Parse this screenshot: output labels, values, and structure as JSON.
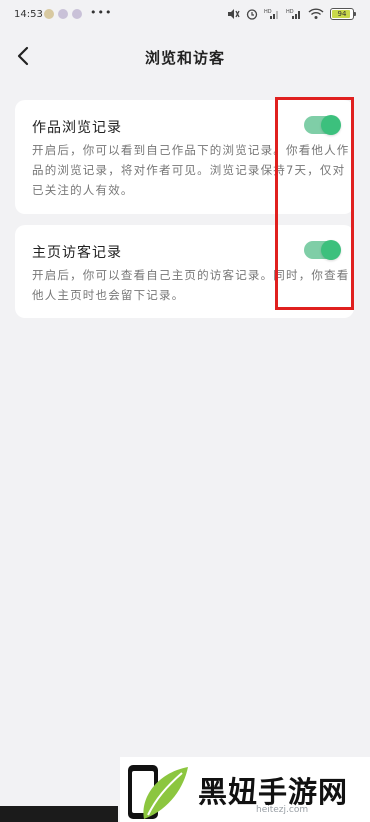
{
  "status_bar": {
    "time": "14:53",
    "more": "•••",
    "battery_level": 0.9,
    "battery_text": "94",
    "icons": [
      "notification-icon",
      "notification-icon",
      "mute-icon",
      "alarm-icon",
      "signal-hd-icon",
      "signal-hd-icon",
      "wifi-icon",
      "battery-icon"
    ]
  },
  "header": {
    "title": "浏览和访客",
    "back_icon": "chevron-left-icon"
  },
  "settings": [
    {
      "title": "作品浏览记录",
      "description": "开启后，你可以看到自己作品下的浏览记录。你看他人作品的浏览记录，将对作者可见。浏览记录保持7天，仅对已关注的人有效。",
      "enabled": true
    },
    {
      "title": "主页访客记录",
      "description": "开启后，你可以查看自己主页的访客记录。同时，你查看他人主页时也会留下记录。",
      "enabled": true
    }
  ],
  "colors": {
    "toggle_on_track": "#7fcea7",
    "toggle_on_knob": "#3cc07d",
    "highlight": "#e0201f",
    "background": "#f2f2f4"
  },
  "watermark": {
    "text": "黑妞手游网",
    "url": "heitezj.com"
  }
}
